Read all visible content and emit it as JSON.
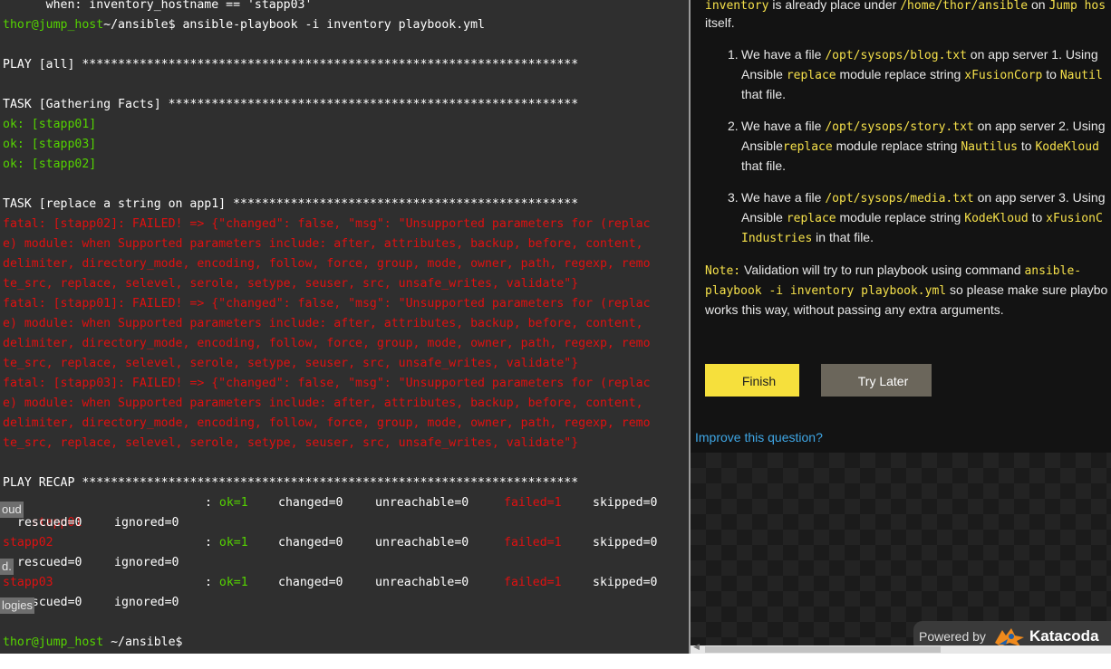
{
  "terminal": {
    "lines": [
      "      when: inventory_hostname == 'stapp03'",
      "~/ansible$ ansible-playbook -i inventory playbook.yml",
      "",
      "PLAY [all] *********************************************************************",
      "",
      "TASK [Gathering Facts] *********************************************************",
      "ok: [stapp01]",
      "ok: [stapp03]",
      "ok: [stapp02]",
      "",
      "TASK [replace a string on app1] ************************************************",
      "fatal: [stapp02]: FAILED! => {\"changed\": false, \"msg\": \"Unsupported parameters for (replac",
      "e) module: when Supported parameters include: after, attributes, backup, before, content,",
      "delimiter, directory_mode, encoding, follow, force, group, mode, owner, path, regexp, remo",
      "te_src, replace, selevel, serole, setype, seuser, src, unsafe_writes, validate\"}",
      "fatal: [stapp01]: FAILED! => {\"changed\": false, \"msg\": \"Unsupported parameters for (replac",
      "e) module: when Supported parameters include: after, attributes, backup, before, content,",
      "delimiter, directory_mode, encoding, follow, force, group, mode, owner, path, regexp, remo",
      "te_src, replace, selevel, serole, setype, seuser, src, unsafe_writes, validate\"}",
      "fatal: [stapp03]: FAILED! => {\"changed\": false, \"msg\": \"Unsupported parameters for (replac",
      "e) module: when Supported parameters include: after, attributes, backup, before, content,",
      "delimiter, directory_mode, encoding, follow, force, group, mode, owner, path, regexp, remo",
      "te_src, replace, selevel, serole, setype, seuser, src, unsafe_writes, validate\"}",
      "",
      "PLAY RECAP *********************************************************************"
    ],
    "prompt_user": "thor@jump_host",
    "recap": [
      {
        "host": "stapp01",
        "ok": "ok=1",
        "changed": "changed=0",
        "unreachable": "unreachable=0",
        "failed": "failed=1",
        "skipped": "skipped=0",
        "rescued": "rescued=0",
        "ignored": "ignored=0"
      },
      {
        "host": "stapp02",
        "ok": "ok=1",
        "changed": "changed=0",
        "unreachable": "unreachable=0",
        "failed": "failed=1",
        "skipped": "skipped=0",
        "rescued": "rescued=0",
        "ignored": "ignored=0"
      },
      {
        "host": "stapp03",
        "ok": "ok=1",
        "changed": "changed=0",
        "unreachable": "unreachable=0",
        "failed": "failed=1",
        "skipped": "skipped=0",
        "rescued": "rescued=0",
        "ignored": "ignored=0"
      }
    ],
    "final_prompt_user": "thor@jump_host",
    "final_prompt_path": " ~/ansible$",
    "overlay_tags": [
      "oud",
      "d.",
      "logies"
    ]
  },
  "panel": {
    "intro_line1_code1": "inventory",
    "intro_line1_text1": " is already place under ",
    "intro_line1_code2": "/home/thor/ansible",
    "intro_line1_text2": " on ",
    "intro_line1_code3": "Jump hos",
    "intro_line2": "itself.",
    "items": [
      {
        "num": "1.",
        "l1_a": "We have a file ",
        "l1_code": "/opt/sysops/blog.txt",
        "l1_b": " on app server 1. Using",
        "l2_a": "Ansible ",
        "l2_code1": "replace",
        "l2_b": " module replace string ",
        "l2_code2": "xFusionCorp",
        "l2_c": " to ",
        "l2_code3": "Nautil",
        "l3": "that file."
      },
      {
        "num": "2.",
        "l1_a": "We have a file ",
        "l1_code": "/opt/sysops/story.txt",
        "l1_b": " on app server 2. Using",
        "l2_a": "Ansible",
        "l2_code1": "replace",
        "l2_b": " module replace string ",
        "l2_code2": "Nautilus",
        "l2_c": " to ",
        "l2_code3": "KodeKloud",
        "l3": "that file."
      },
      {
        "num": "3.",
        "l1_a": "We have a file ",
        "l1_code": "/opt/sysops/media.txt",
        "l1_b": " on app server 3. Using",
        "l2_a": "Ansible ",
        "l2_code1": "replace",
        "l2_b": " module replace string ",
        "l2_code2": "KodeKloud",
        "l2_c": " to ",
        "l2_code3": "xFusionC",
        "l3_code": "Industries",
        "l3": " in that file."
      }
    ],
    "note_label": "Note:",
    "note_l1_a": " Validation will try to run playbook using command ",
    "note_l1_code": "ansible-",
    "note_l2_code": "playbook -i inventory playbook.yml",
    "note_l2_b": " so please make sure playbo",
    "note_l3": "works this way, without passing any extra arguments.",
    "finish_label": "Finish",
    "try_later_label": "Try Later",
    "improve_link": "Improve this question?",
    "powered_by": "Powered by",
    "brand": "Katacoda"
  }
}
